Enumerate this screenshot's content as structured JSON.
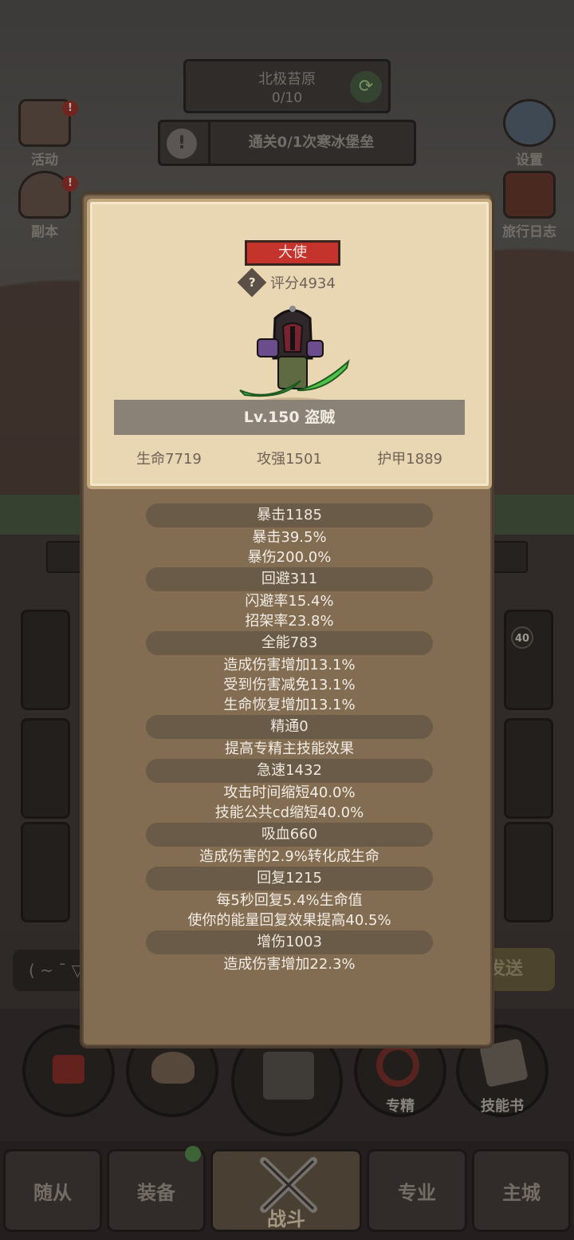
{
  "hud": {
    "region_name": "北极苔原",
    "region_progress": "0/10",
    "quest_text": "通关0/1次寒冰堡垒",
    "left_buttons": [
      {
        "label": "活动",
        "icon": "activity-board-icon"
      },
      {
        "label": "副本",
        "icon": "dungeon-portal-icon"
      }
    ],
    "right_buttons": [
      {
        "label": "设置",
        "icon": "gear-icon"
      },
      {
        "label": "旅行日志",
        "icon": "journal-book-icon"
      }
    ]
  },
  "chat": {
    "input_text": "( ~ ¯ ▽",
    "send_label": "发送"
  },
  "actions": [
    {
      "label": "",
      "icon": "potion-icon"
    },
    {
      "label": "",
      "icon": "bread-icon"
    },
    {
      "label": "",
      "icon": "treasure-chest-icon"
    },
    {
      "label": "专精",
      "icon": "specialization-icon"
    },
    {
      "label": "技能书",
      "icon": "skill-book-icon"
    }
  ],
  "slot_level_badge": "40",
  "bottom_nav": [
    {
      "label": "随从",
      "active": false
    },
    {
      "label": "装备",
      "active": false
    },
    {
      "label": "战斗",
      "active": true
    },
    {
      "label": "专业",
      "active": false
    },
    {
      "label": "主城",
      "active": false
    }
  ],
  "popup": {
    "rank": "大使",
    "score": "评分4934",
    "level_class": "Lv.150 盗贼",
    "base_stats": [
      "生命7719",
      "攻强1501",
      "护甲1889"
    ],
    "stat_groups": [
      {
        "title": "暴击1185",
        "lines": [
          "暴击39.5%",
          "暴伤200.0%"
        ]
      },
      {
        "title": "回避311",
        "lines": [
          "闪避率15.4%",
          "招架率23.8%"
        ]
      },
      {
        "title": "全能783",
        "lines": [
          "造成伤害增加13.1%",
          "受到伤害减免13.1%",
          "生命恢复增加13.1%"
        ]
      },
      {
        "title": "精通0",
        "lines": [
          "提高专精主技能效果"
        ]
      },
      {
        "title": "急速1432",
        "lines": [
          "攻击时间缩短40.0%",
          "技能公共cd缩短40.0%"
        ]
      },
      {
        "title": "吸血660",
        "lines": [
          "造成伤害的2.9%转化成生命"
        ]
      },
      {
        "title": "回复1215",
        "lines": [
          "每5秒回复5.4%生命值",
          "使你的能量回复效果提高40.5%"
        ]
      },
      {
        "title": "增伤1003",
        "lines": [
          "造成伤害增加22.3%"
        ]
      }
    ]
  },
  "colors": {
    "rank_badge": "#c5332d",
    "parchment": "#e9d6b2",
    "panel": "#826c52",
    "blade_green": "#4fc04a"
  }
}
